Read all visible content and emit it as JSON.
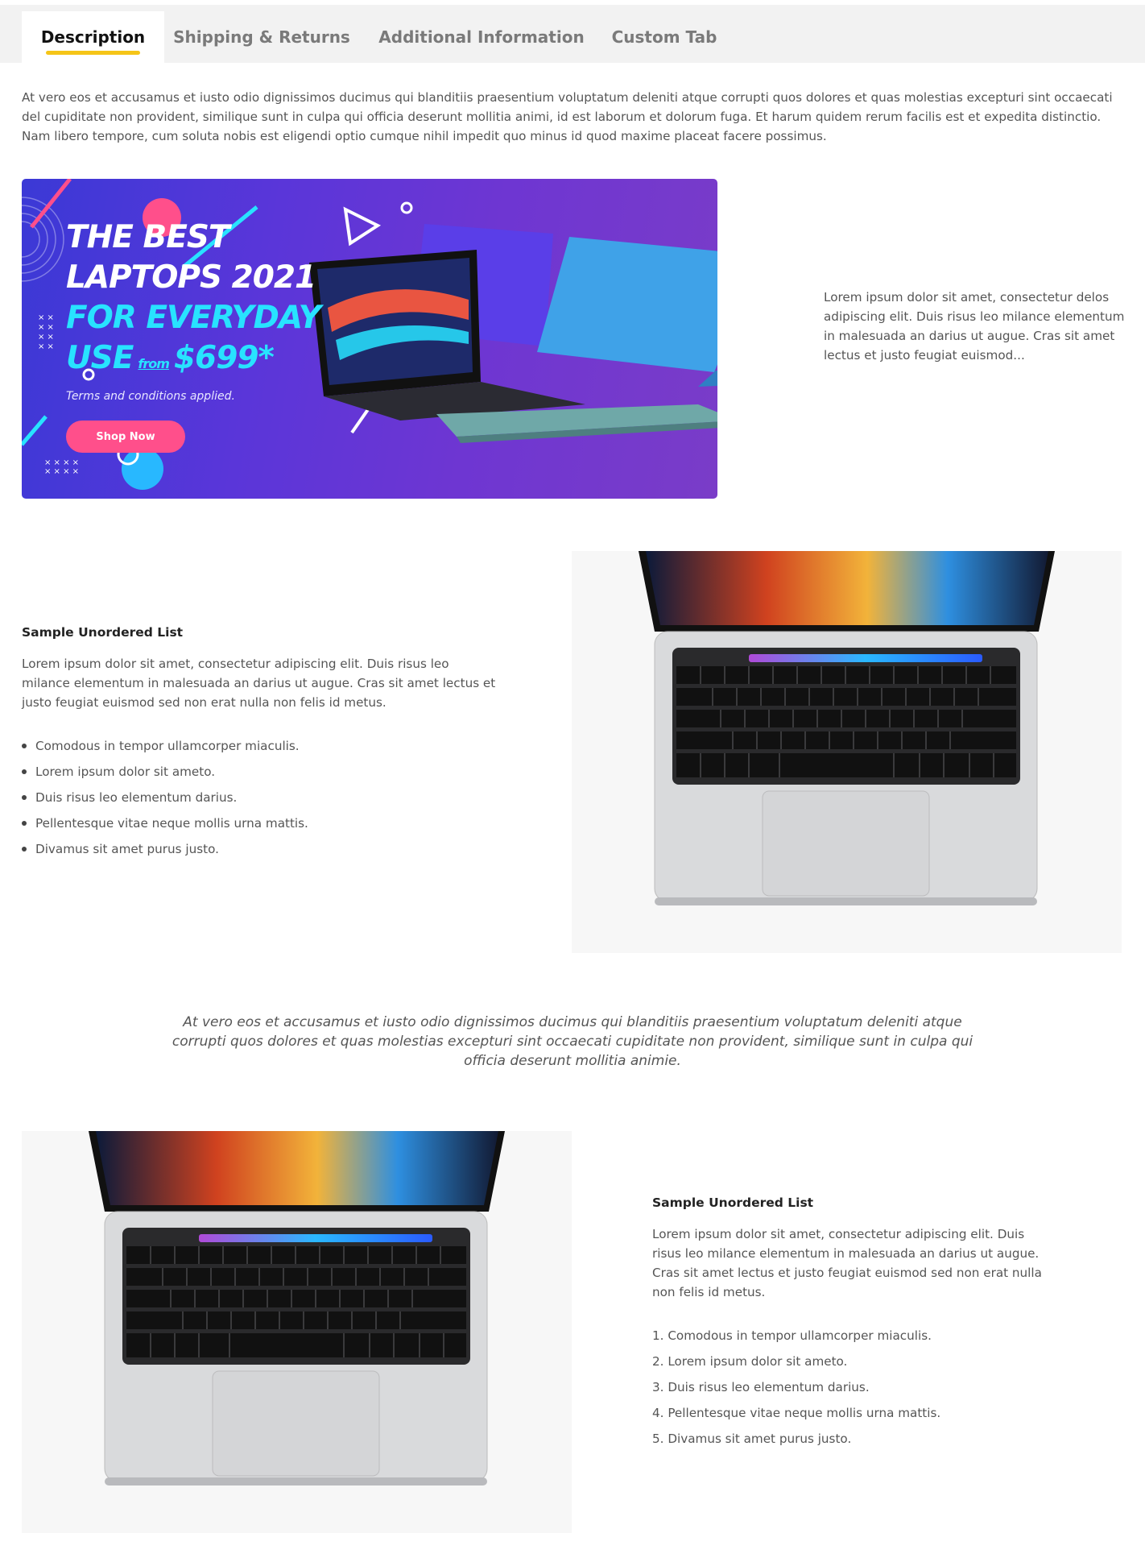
{
  "tabs": [
    {
      "label": "Description",
      "active": true
    },
    {
      "label": "Shipping & Returns",
      "active": false
    },
    {
      "label": "Additional Information",
      "active": false
    },
    {
      "label": "Custom Tab",
      "active": false
    }
  ],
  "description": {
    "intro": "At vero eos et accusamus et iusto odio dignissimos ducimus qui blanditiis praesentium voluptatum deleniti atque corrupti quos dolores et quas molestias excepturi sint occaecati del cupiditate non provident, similique sunt in culpa qui officia deserunt mollitia animi, id est laborum et dolorum fuga. Et harum quidem rerum facilis est et expedita distinctio. Nam libero tempore, cum soluta nobis est eligendi optio cumque nihil impedit quo minus id quod maxime placeat facere possimus."
  },
  "banner": {
    "line1": "THE BEST",
    "line2": "LAPTOPS 2021",
    "line3": "FOR EVERYDAY",
    "use": "USE",
    "from": "from",
    "price": "$699*",
    "terms": "Terms and conditions applied.",
    "button": "Shop Now",
    "accent": "#28e3ff",
    "button_color": "#ff4f8b"
  },
  "banner_side_text": "Lorem ipsum dolor sit amet, consectetur delos adipiscing elit. Duis risus leo milance elementum in malesuada an darius ut augue. Cras sit amet lectus et justo feugiat euismod...",
  "section1": {
    "title": "Sample Unordered List",
    "paragraph": "Lorem ipsum dolor sit amet, consectetur adipiscing elit. Duis risus leo milance elementum in malesuada an darius ut augue. Cras sit amet lectus et justo feugiat euismod sed non erat nulla non felis id metus.",
    "items": [
      "Comodous in tempor ullamcorper miaculis.",
      "Lorem ipsum dolor sit ameto.",
      "Duis risus leo elementum darius.",
      "Pellentesque vitae neque mollis urna mattis.",
      "Divamus sit amet purus justo."
    ]
  },
  "quote": "At vero eos et accusamus et iusto odio dignissimos ducimus qui blanditiis praesentium voluptatum deleniti atque corrupti quos dolores et quas molestias excepturi sint occaecati cupiditate non provident, similique sunt in culpa qui officia deserunt mollitia animie.",
  "section2": {
    "title": "Sample Unordered List",
    "paragraph": "Lorem ipsum dolor sit amet, consectetur adipiscing elit. Duis risus leo milance elementum in malesuada an darius ut augue. Cras sit amet lectus et justo feugiat euismod sed non erat nulla non felis id metus.",
    "items": [
      "1. Comodous in tempor ullamcorper miaculis.",
      "2. Lorem ipsum dolor sit ameto.",
      "3. Duis risus leo elementum darius.",
      "4. Pellentesque vitae neque mollis urna mattis.",
      "5. Divamus sit amet purus justo."
    ]
  }
}
